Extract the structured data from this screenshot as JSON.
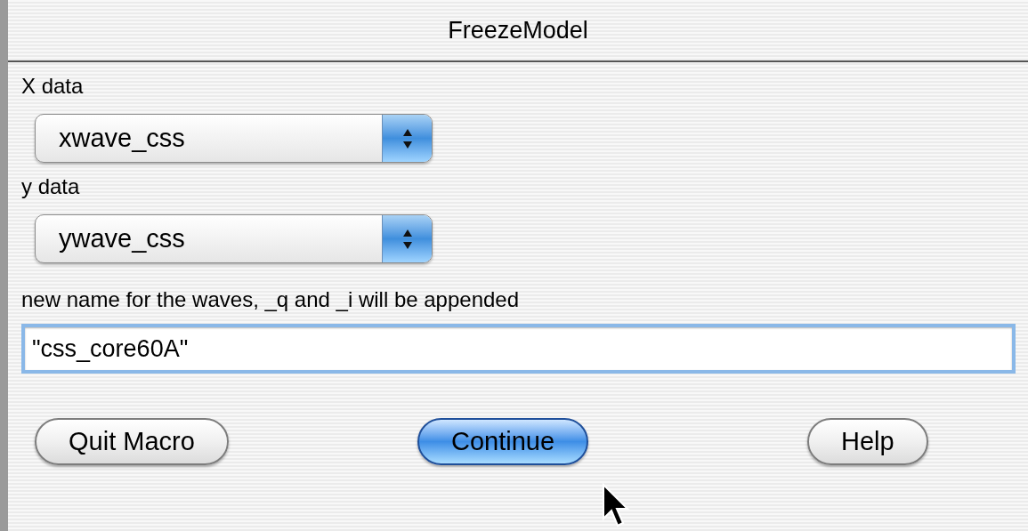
{
  "window": {
    "title": "FreezeModel"
  },
  "fields": [
    {
      "kind": "popup",
      "label": "X data",
      "value": "xwave_css"
    },
    {
      "kind": "popup",
      "label": "y data",
      "value": "ywave_css"
    },
    {
      "kind": "text",
      "label": "new name for the waves, _q and _i will be appended",
      "value": "\"css_core60A\"",
      "focused": true
    }
  ],
  "buttons": [
    {
      "label": "Quit Macro",
      "default": false
    },
    {
      "label": "Continue",
      "default": true
    },
    {
      "label": "Help",
      "default": false
    }
  ]
}
